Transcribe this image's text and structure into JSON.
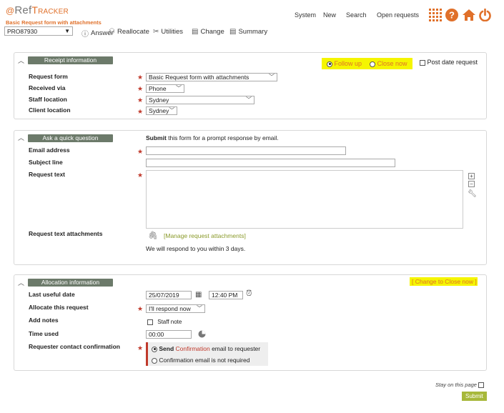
{
  "header": {
    "logo_symbol": "@",
    "logo_ref": "Ref",
    "logo_tracker": "Tracker",
    "subtitle": "Basic Request form with attachments",
    "request_id": "PRO87930",
    "nav": [
      "System",
      "New",
      "Search",
      "Open requests"
    ],
    "toolbar": [
      "Answer",
      "Reallocate",
      "Utilities",
      "Change",
      "Summary"
    ]
  },
  "receipt": {
    "title": "Receipt information",
    "follow_up": "Follow up",
    "close_now": "Close now",
    "post_date": "Post date request",
    "fields": [
      {
        "label": "Request form",
        "value": "Basic Request form with attachments"
      },
      {
        "label": "Received via",
        "value": "Phone"
      },
      {
        "label": "Staff location",
        "value": "Sydney"
      },
      {
        "label": "Client location",
        "value": "Sydney"
      }
    ]
  },
  "question": {
    "title": "Ask a quick question",
    "submit_bold": "Submit",
    "submit_rest": " this form for a prompt response by email.",
    "email_label": "Email address",
    "subject_label": "Subject line",
    "text_label": "Request text",
    "attach_label": "Request text attachments",
    "attach_link": "[Manage request attachments]",
    "respond_note": "We will respond to you within 3 days."
  },
  "allocation": {
    "title": "Allocation information",
    "change_link": "[ Change to Close now ]",
    "last_useful_label": "Last useful date",
    "last_useful_date": "25/07/2019",
    "last_useful_time": "12:40 PM",
    "allocate_label": "Allocate this request",
    "allocate_value": "I'll respond now",
    "notes_label": "Add notes",
    "staff_note": "Staff note",
    "time_used_label": "Time used",
    "time_used_value": "00:00",
    "confirm_label": "Requester contact confirmation",
    "confirm_send_pre": "Send ",
    "confirm_send_mid": "Confirmation",
    "confirm_send_post": " email to requester",
    "confirm_none": "Confirmation email is not required"
  },
  "footer": {
    "stay": "Stay on this page",
    "submit": "Submit"
  },
  "colors": {
    "accent": "#e0702a",
    "pill": "#6c7a6a",
    "highlight": "#f5f500",
    "submit": "#a7b83a"
  }
}
